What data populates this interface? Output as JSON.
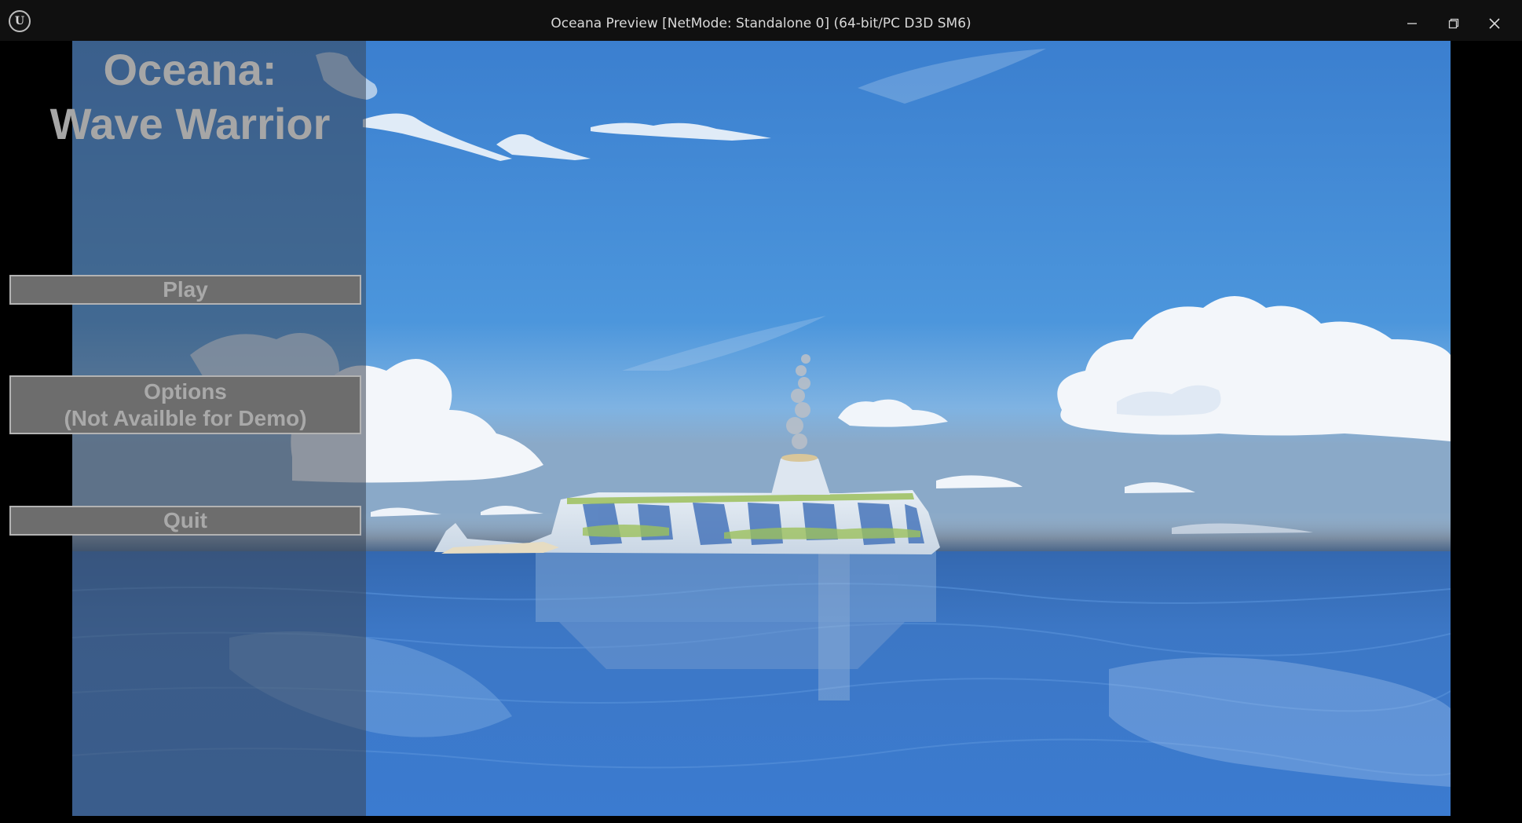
{
  "window": {
    "title": "Oceana Preview [NetMode: Standalone 0]  (64-bit/PC D3D SM6)",
    "logo_icon": "unreal-engine-logo",
    "logo_text": "U",
    "controls": [
      "minimize-icon",
      "restore-icon",
      "close-icon"
    ]
  },
  "menu": {
    "title_line1": "Oceana:",
    "title_line2": "Wave Warrior",
    "play_label": "Play",
    "options_label_line1": "Options",
    "options_label_line2": "(Not Availble for Demo)",
    "quit_label": "Quit"
  },
  "colors": {
    "sky_top": "#3f86d4",
    "sea": "#3a78c8",
    "panel": "#3a4656",
    "button": "#6d6d6d",
    "text": "#a9a9a9"
  }
}
